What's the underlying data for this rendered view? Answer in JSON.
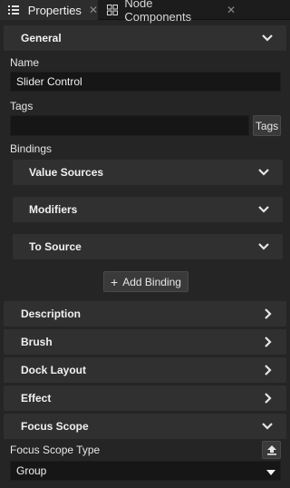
{
  "tabs": [
    {
      "label": "Properties",
      "icon": "list-icon",
      "active": true
    },
    {
      "label": "Node Components",
      "icon": "components-icon",
      "active": false
    }
  ],
  "general": {
    "title": "General",
    "name_label": "Name",
    "name_value": "Slider Control",
    "tags_label": "Tags",
    "tags_value": "",
    "tags_button": "Tags",
    "bindings_label": "Bindings",
    "binding_sections": [
      "Value Sources",
      "Modifiers",
      "To Source"
    ],
    "add_binding": "Add Binding"
  },
  "collapsed_sections": [
    "Description",
    "Brush",
    "Dock Layout",
    "Effect"
  ],
  "focus_scope": {
    "title": "Focus Scope",
    "type_label": "Focus Scope Type",
    "type_value": "Group"
  },
  "colors": {
    "background": "#252525",
    "section": "#303030",
    "field": "#161616"
  }
}
